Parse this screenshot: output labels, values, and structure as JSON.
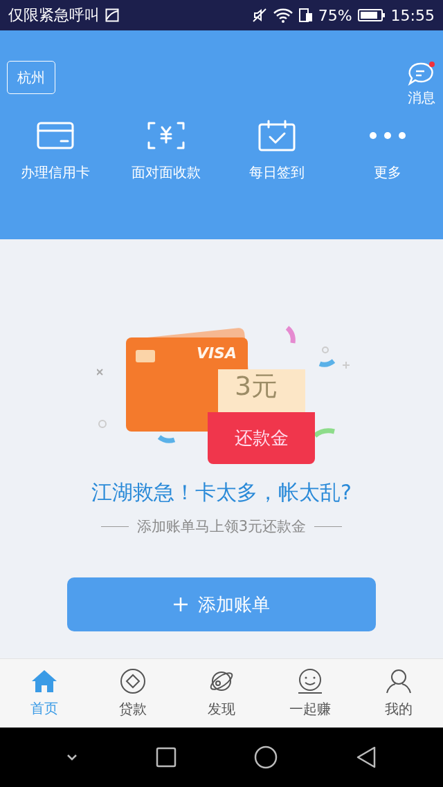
{
  "status_bar": {
    "carrier": "仅限紧急呼叫",
    "battery": "75%",
    "time": "15:55"
  },
  "header": {
    "city": "杭州",
    "messages": "消息",
    "actions": [
      {
        "kind": "card",
        "label": "办理信用卡"
      },
      {
        "kind": "scan",
        "label": "面对面收款"
      },
      {
        "kind": "calendar",
        "label": "每日签到"
      },
      {
        "kind": "more",
        "label": "更多"
      }
    ]
  },
  "promo": {
    "card_brand": "VISA",
    "voucher_amount": "3元",
    "voucher_label": "还款金",
    "headline": "江湖救急！卡太多，帐太乱?",
    "subtitle": "添加账单马上领3元还款金",
    "button": "添加账单"
  },
  "tabs": [
    {
      "kind": "home",
      "label": "首页",
      "selected": true
    },
    {
      "kind": "loan",
      "label": "贷款",
      "selected": false
    },
    {
      "kind": "discover",
      "label": "发现",
      "selected": false
    },
    {
      "kind": "earn",
      "label": "一起赚",
      "selected": false
    },
    {
      "kind": "me",
      "label": "我的",
      "selected": false
    }
  ]
}
